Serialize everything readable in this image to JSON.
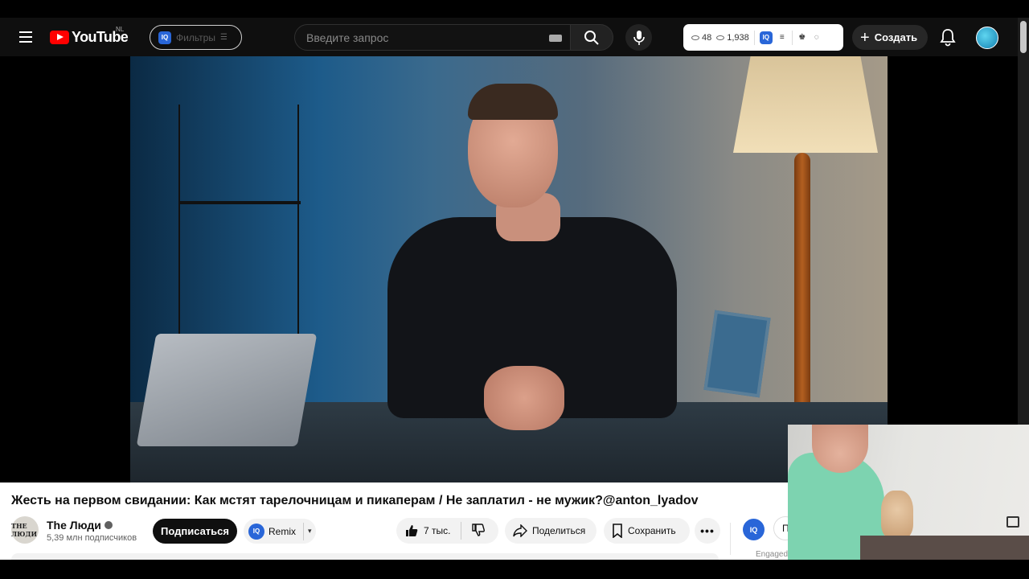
{
  "masthead": {
    "logo_text": "YouTube",
    "region": "NL",
    "filters_label": "Фильтры",
    "iq_label": "IQ",
    "search_placeholder": "Введите запрос",
    "stats": {
      "watching": "48",
      "views": "1,938"
    },
    "create_label": "Создать"
  },
  "video": {
    "title": "Жесть на первом свидании: Как мстят тарелочницам и пикаперам / Не заплатил - не мужик?@anton_lyadov"
  },
  "channel": {
    "name": "The Люди",
    "avatar_text": "THE ЛЮДИ",
    "subscribers": "5,39 млн подписчиков",
    "subscribe_label": "Подписаться",
    "remix_label": "Remix"
  },
  "actions": {
    "likes": "7 тыс.",
    "share_label": "Поделиться",
    "save_label": "Сохранить",
    "more_label": "•••",
    "partial_label": "П",
    "engaged_label": "Engaged"
  },
  "colors": {
    "brand": "#ff0000",
    "iq_blue": "#2966d8",
    "masthead_bg": "#0f0f0f"
  }
}
